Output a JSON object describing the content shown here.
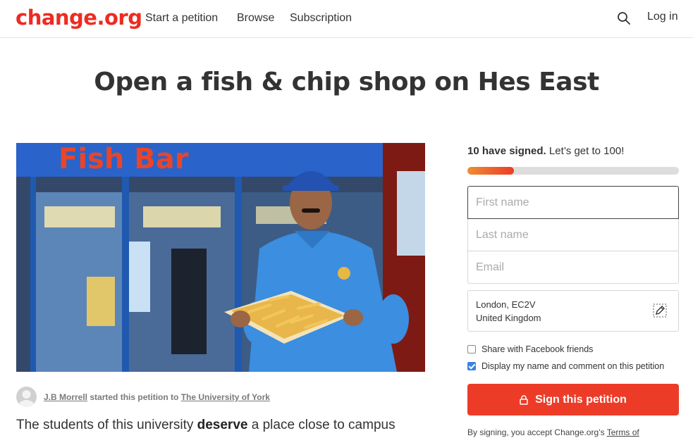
{
  "header": {
    "logo": "change.org",
    "nav": [
      "Start a petition",
      "Browse",
      "Subscription"
    ],
    "login": "Log in",
    "icons": {
      "search": "search-icon"
    }
  },
  "petition": {
    "title": "Open a fish & chip shop on Hes East",
    "photo_sign_text": "Fish Bar",
    "starter": {
      "name": "J.B Morrell",
      "middle": " started this petition to ",
      "target": "The University of York"
    },
    "description": {
      "before": "The students of this university ",
      "bold": "deserve",
      "after": " a place close to campus"
    }
  },
  "signature": {
    "count_text": "10 have signed.",
    "goal_text": " Let’s get to 100!",
    "progress": 0.22,
    "first_name_placeholder": "First name",
    "last_name_placeholder": "Last name",
    "email_placeholder": "Email",
    "location_line1": "London, EC2V",
    "location_line2": "United Kingdom",
    "share_facebook": "Share with Facebook friends",
    "share_facebook_checked": false,
    "display_name": "Display my name and comment on this petition",
    "display_name_checked": true,
    "sign_button": "Sign this petition",
    "terms_prefix": "By signing, you accept Change.org’s ",
    "terms_link": "Terms of"
  },
  "colors": {
    "brand": "#ec2c22",
    "button": "#ec3c28",
    "checkbox": "#3b82e6"
  }
}
